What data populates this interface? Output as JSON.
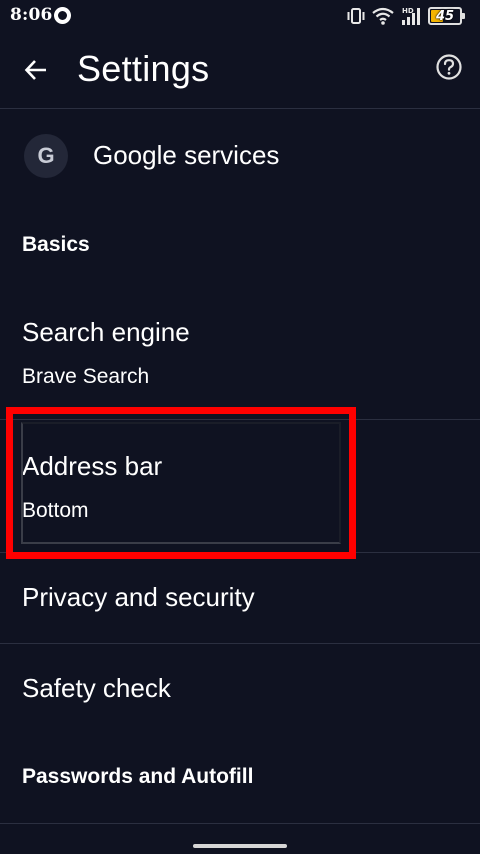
{
  "status_bar": {
    "time": "8:06",
    "network_badge": "HD",
    "battery_level": 45,
    "battery_text": "45"
  },
  "app_bar": {
    "title": "Settings",
    "back_icon": "arrow-left-icon",
    "help_icon": "help-circle-icon"
  },
  "google_services": {
    "avatar_letter": "G",
    "label": "Google services"
  },
  "sections": {
    "basics": "Basics",
    "passwords": "Passwords and Autofill"
  },
  "items": {
    "search_engine": {
      "title": "Search engine",
      "summary": "Brave Search"
    },
    "address_bar": {
      "title": "Address bar",
      "summary": "Bottom"
    },
    "privacy": {
      "title": "Privacy and security"
    },
    "safety": {
      "title": "Safety check"
    }
  },
  "colors": {
    "background": "#0f1221",
    "text": "#ffffff",
    "highlight": "#ff0000",
    "divider": "#2b2f40",
    "battery": "#f4b400"
  }
}
